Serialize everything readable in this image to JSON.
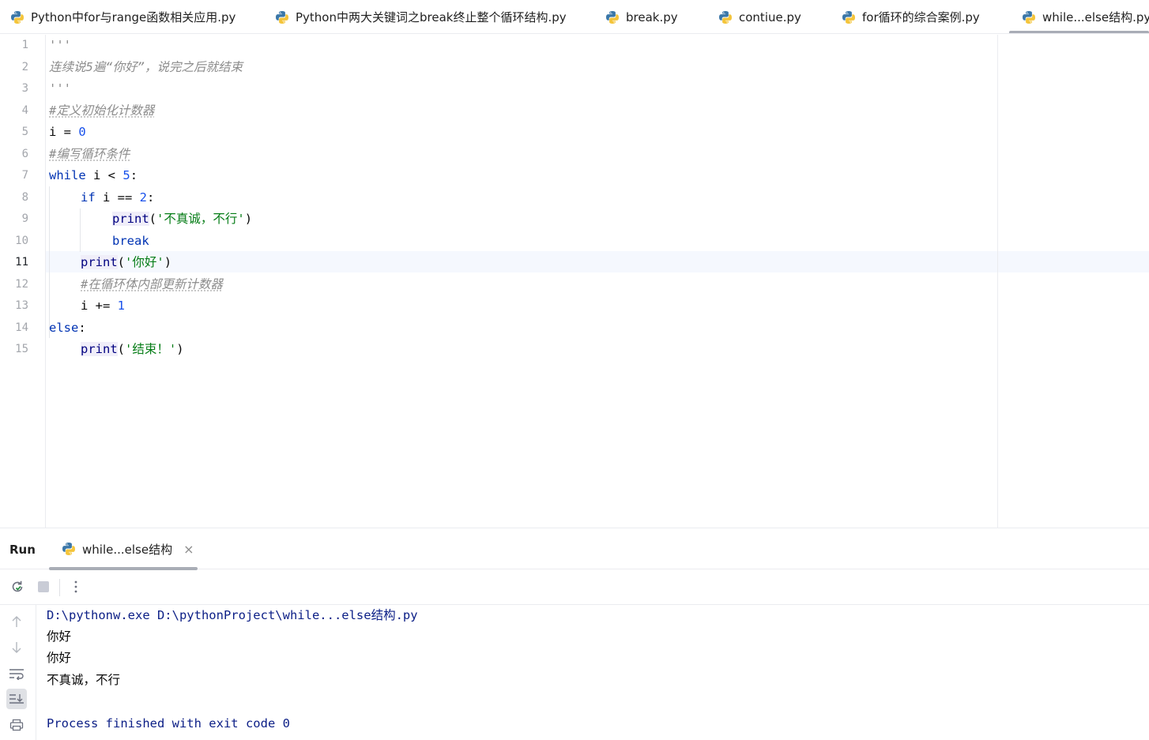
{
  "tabs": [
    {
      "label": "Python中for与range函数相关应用.py",
      "active": false
    },
    {
      "label": "Python中两大关键词之break终止整个循环结构.py",
      "active": false
    },
    {
      "label": "break.py",
      "active": false
    },
    {
      "label": "contiue.py",
      "active": false
    },
    {
      "label": "for循环的综合案例.py",
      "active": false
    },
    {
      "label": "while...else结构.py",
      "active": true
    }
  ],
  "editor": {
    "current_line": 11,
    "line_numbers": [
      "1",
      "2",
      "3",
      "4",
      "5",
      "6",
      "7",
      "8",
      "9",
      "10",
      "11",
      "12",
      "13",
      "14",
      "15"
    ],
    "lines": {
      "l1": {
        "doc": "'''"
      },
      "l2": {
        "doc": "连续说5遍“你好”，说完之后就结束"
      },
      "l3": {
        "doc": "'''"
      },
      "l4": {
        "comment": "#定义初始化计数器"
      },
      "l5": {
        "name": "i",
        "op": " = ",
        "num": "0"
      },
      "l6": {
        "comment": "#编写循环条件"
      },
      "l7": {
        "kw": "while",
        "mid": " i < ",
        "num": "5",
        "end": ":"
      },
      "l8": {
        "kw": "if",
        "mid": " i == ",
        "num": "2",
        "end": ":"
      },
      "l9": {
        "fn": "print",
        "open": "(",
        "str": "'不真诚，不行'",
        "close": ")"
      },
      "l10": {
        "kw": "break"
      },
      "l11": {
        "fn": "print",
        "open": "(",
        "str": "'你好'",
        "close": ")"
      },
      "l12": {
        "comment": "#在循环体内部更新计数器"
      },
      "l13": {
        "name": "i",
        "op": " += ",
        "num": "1"
      },
      "l14": {
        "kw": "else",
        "end": ":"
      },
      "l15": {
        "fn": "print",
        "open": "(",
        "str": "'结束！'",
        "close": ")"
      }
    }
  },
  "run": {
    "title": "Run",
    "tab_label": "while...else结构",
    "close_glyph": "×",
    "console": [
      "D:\\pythonw.exe D:\\pythonProject\\while...else结构.py",
      "你好",
      "你好",
      "不真诚，不行",
      "",
      "Process finished with exit code 0"
    ]
  },
  "colors": {
    "keyword": "#0033b3",
    "number": "#1750eb",
    "string": "#067d17",
    "comment": "#8c8c8c",
    "builtin": "#000080",
    "console_system": "#0b1e86",
    "rerun_icon": "#208a3c"
  },
  "icons": {
    "tab": "python-file-icon",
    "rerun": "rerun-icon",
    "stop": "stop-icon",
    "more": "more-vertical-icon",
    "up": "arrow-up-icon",
    "down": "arrow-down-icon",
    "wrap": "soft-wrap-icon",
    "scroll": "scroll-to-end-icon",
    "print": "print-icon"
  }
}
